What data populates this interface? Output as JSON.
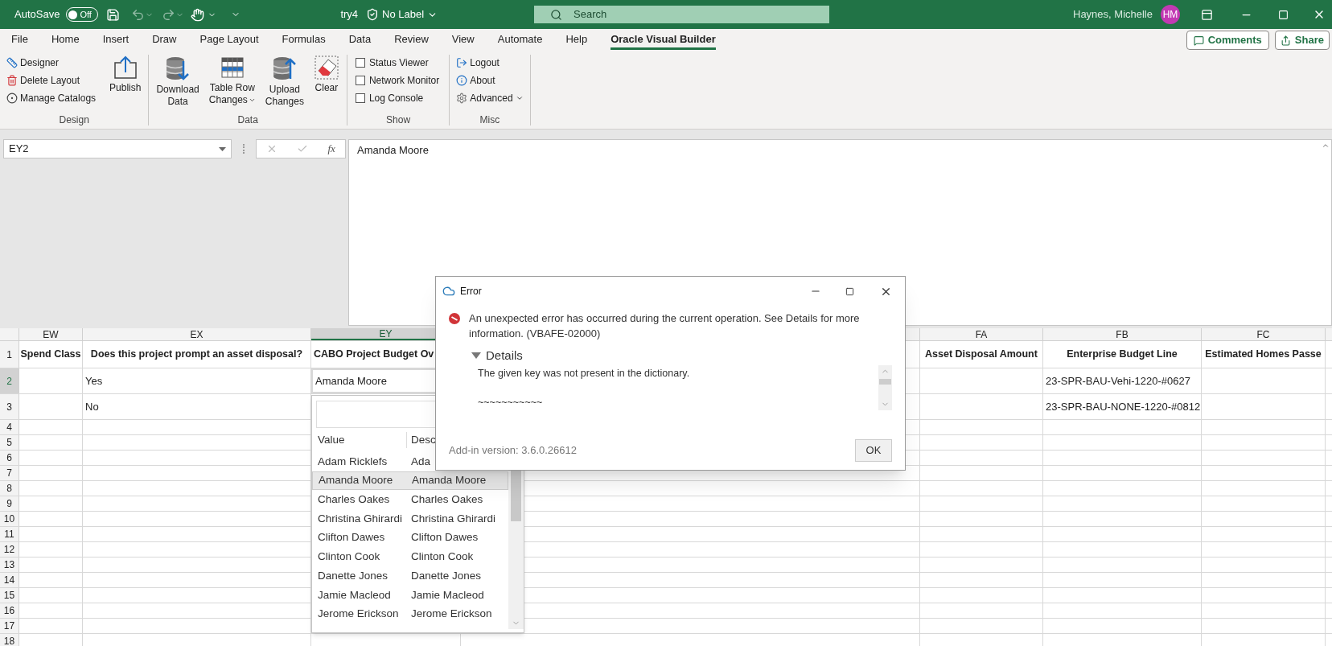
{
  "title_bar": {
    "autosave_label": "AutoSave",
    "autosave_toggle": {
      "label": "Off",
      "on": false
    },
    "file_name": "try4",
    "sensitivity_label": "No Label",
    "search_placeholder": "Search",
    "user_name": "Haynes, Michelle",
    "user_initials": "HM"
  },
  "ribbon_tabs": [
    {
      "label": "File",
      "selected": false
    },
    {
      "label": "Home",
      "selected": false
    },
    {
      "label": "Insert",
      "selected": false
    },
    {
      "label": "Draw",
      "selected": false
    },
    {
      "label": "Page Layout",
      "selected": false
    },
    {
      "label": "Formulas",
      "selected": false
    },
    {
      "label": "Data",
      "selected": false
    },
    {
      "label": "Review",
      "selected": false
    },
    {
      "label": "View",
      "selected": false
    },
    {
      "label": "Automate",
      "selected": false
    },
    {
      "label": "Help",
      "selected": false
    },
    {
      "label": "Oracle Visual Builder",
      "selected": true
    }
  ],
  "ribbon_buttons": [
    "Comments",
    "Share"
  ],
  "ribbon_groups": [
    {
      "label": "Design",
      "kind": "mixed",
      "small_buttons": [
        {
          "label": "Designer",
          "dropdown": false
        },
        {
          "label": "Delete Layout",
          "dropdown": false
        },
        {
          "label": "Manage Catalogs",
          "dropdown": false
        }
      ],
      "large_buttons": [
        {
          "lines": [
            "Publish"
          ],
          "dropdown": false
        }
      ]
    },
    {
      "label": "Data",
      "kind": "large",
      "large_buttons": [
        {
          "lines": [
            "Download",
            "Data"
          ],
          "dropdown": false
        },
        {
          "lines": [
            "Table Row",
            "Changes"
          ],
          "dropdown": true
        },
        {
          "lines": [
            "Upload",
            "Changes"
          ],
          "dropdown": false
        },
        {
          "lines": [
            "Clear"
          ],
          "dropdown": false
        }
      ]
    },
    {
      "label": "Show",
      "kind": "checkboxes",
      "checkboxes": [
        {
          "label": "Status Viewer",
          "checked": false
        },
        {
          "label": "Network Monitor",
          "checked": false
        },
        {
          "label": "Log Console",
          "checked": false
        }
      ]
    },
    {
      "label": "Misc",
      "kind": "small",
      "small_buttons": [
        {
          "label": "Logout",
          "dropdown": false
        },
        {
          "label": "About",
          "dropdown": false
        },
        {
          "label": "Advanced",
          "dropdown": true
        }
      ]
    }
  ],
  "formula_bar": {
    "name_box": "EY2",
    "function_label": "fx",
    "formula": "Amanda Moore"
  },
  "sheet": {
    "columns": [
      {
        "letter": "EW",
        "selected": false
      },
      {
        "letter": "EX",
        "selected": false
      },
      {
        "letter": "EY",
        "selected": true
      },
      {
        "letter": "FA",
        "selected": false
      },
      {
        "letter": "FB",
        "selected": false
      },
      {
        "letter": "FC",
        "selected": false
      }
    ],
    "rows": [
      {
        "number": "1",
        "selected": false,
        "cells": [
          "Spend Class",
          "Does this project prompt an asset disposal?",
          "CABO Project Budget Ov",
          "Asset Disposal Amount",
          "Enterprise Budget Line",
          "Estimated Homes Passe"
        ]
      },
      {
        "number": "2",
        "selected": true,
        "cells": [
          "",
          "Yes",
          "Amanda Moore",
          "",
          "23-SPR-BAU-Vehi-1220-#0627",
          ""
        ]
      },
      {
        "number": "3",
        "selected": false,
        "cells": [
          "",
          "No",
          "",
          "",
          "23-SPR-BAU-NONE-1220-#0812",
          ""
        ]
      },
      {
        "number": "4",
        "selected": false
      },
      {
        "number": "5",
        "selected": false
      },
      {
        "number": "6",
        "selected": false
      },
      {
        "number": "7",
        "selected": false
      },
      {
        "number": "8",
        "selected": false
      },
      {
        "number": "9",
        "selected": false
      },
      {
        "number": "10",
        "selected": false
      },
      {
        "number": "11",
        "selected": false
      },
      {
        "number": "12",
        "selected": false
      },
      {
        "number": "13",
        "selected": false
      },
      {
        "number": "14",
        "selected": false
      },
      {
        "number": "15",
        "selected": false
      },
      {
        "number": "16",
        "selected": false
      },
      {
        "number": "17",
        "selected": false
      },
      {
        "number": "18",
        "selected": false
      }
    ]
  },
  "dropdown": {
    "columns": [
      "Value",
      "Desc"
    ],
    "items": [
      {
        "value": "Adam Ricklefs",
        "description": "Ada",
        "selected": false
      },
      {
        "value": "Amanda Moore",
        "description": "Amanda Moore",
        "selected": true
      },
      {
        "value": "Charles Oakes",
        "description": "Charles Oakes",
        "selected": false
      },
      {
        "value": "Christina Ghirardi",
        "description": "Christina Ghirardi",
        "selected": false
      },
      {
        "value": "Clifton Dawes",
        "description": "Clifton Dawes",
        "selected": false
      },
      {
        "value": "Clinton Cook",
        "description": "Clinton Cook",
        "selected": false
      },
      {
        "value": "Danette Jones",
        "description": "Danette Jones",
        "selected": false
      },
      {
        "value": "Jamie Macleod",
        "description": "Jamie Macleod",
        "selected": false
      },
      {
        "value": "Jerome Erickson",
        "description": "Jerome Erickson",
        "selected": false
      }
    ]
  },
  "dialog": {
    "title": "Error",
    "message": "An unexpected error has occurred during the current operation. See Details for more information. (VBAFE-02000)",
    "details": {
      "label": "Details",
      "expanded": true,
      "lines": [
        "The given key was not present in the dictionary.",
        "~~~~~~~~~~~"
      ]
    },
    "version": "Add-in version: 3.6.0.26612",
    "button": "OK"
  }
}
